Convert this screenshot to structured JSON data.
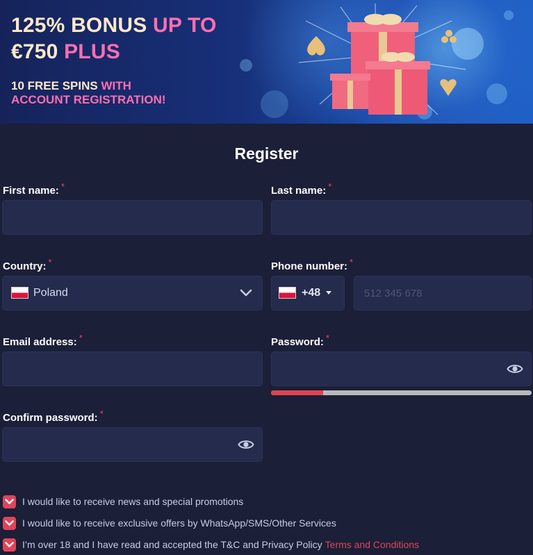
{
  "banner": {
    "line1_white": "125% BONUS",
    "line1_pink": "UP TO",
    "line2_white": "€750",
    "line2_pink": "PLUS",
    "sub1_white": "10 FREE SPINS",
    "sub1_pink": "WITH",
    "sub2_pink": "ACCOUNT REGISTRATION!"
  },
  "form": {
    "title": "Register",
    "required_mark": "*",
    "first_name": {
      "label": "First name:",
      "value": ""
    },
    "last_name": {
      "label": "Last name:",
      "value": ""
    },
    "country": {
      "label": "Country:",
      "value": "Poland",
      "flag": "poland-flag"
    },
    "phone": {
      "label": "Phone number:",
      "code": "+48",
      "placeholder": "512 345 678",
      "flag": "poland-flag"
    },
    "email": {
      "label": "Email address:",
      "value": ""
    },
    "password": {
      "label": "Password:",
      "value": "",
      "strength": 0.2
    },
    "confirm_password": {
      "label": "Confirm password:",
      "value": ""
    }
  },
  "consents": [
    {
      "text": "I would like to receive news and special promotions",
      "checked": true
    },
    {
      "text": "I would like to receive exclusive offers by WhatsApp/SMS/Other Services",
      "checked": true
    },
    {
      "text": "I’m over 18 and I have read and accepted the T&C and Privacy Policy",
      "checked": true,
      "link": "Terms and Conditions"
    }
  ],
  "colors": {
    "background": "#1b1f38",
    "field": "#242b4d",
    "accent": "#e0445a",
    "pink_text": "#ff6fb1",
    "cream_text": "#ffe9c8"
  },
  "icons": [
    "chevron-down-icon",
    "caret-down-icon",
    "eye-icon",
    "check-icon",
    "poland-flag"
  ]
}
